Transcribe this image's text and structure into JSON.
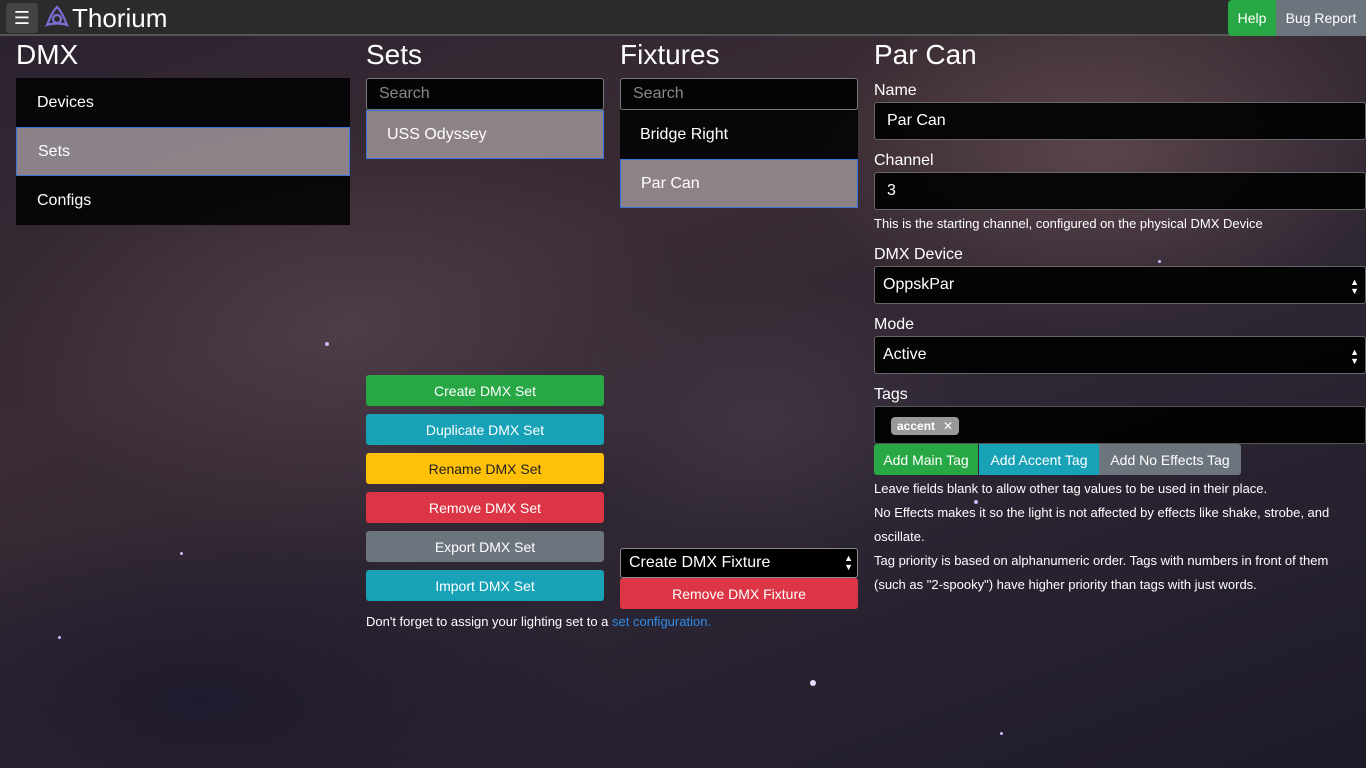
{
  "app": {
    "name": "Thorium",
    "help_label": "Help",
    "bug_report_label": "Bug Report"
  },
  "dmx": {
    "title": "DMX",
    "nav_items": [
      {
        "label": "Devices",
        "active": false
      },
      {
        "label": "Sets",
        "active": true
      },
      {
        "label": "Configs",
        "active": false
      }
    ]
  },
  "sets": {
    "title": "Sets",
    "search_placeholder": "Search",
    "items": [
      {
        "label": "USS Odyssey",
        "active": true
      }
    ],
    "buttons": {
      "create": "Create DMX Set",
      "duplicate": "Duplicate DMX Set",
      "rename": "Rename DMX Set",
      "remove": "Remove DMX Set",
      "export": "Export DMX Set",
      "import": "Import DMX Set"
    },
    "note_prefix": "Don't forget to assign your lighting set to a",
    "note_link": "set configuration."
  },
  "fixtures": {
    "title": "Fixtures",
    "search_placeholder": "Search",
    "items": [
      {
        "label": "Bridge Right",
        "active": false
      },
      {
        "label": "Par Can",
        "active": true
      }
    ],
    "create_select": "Create DMX Fixture",
    "remove_button": "Remove DMX Fixture"
  },
  "detail": {
    "title": "Par Can",
    "name_label": "Name",
    "name_value": "Par Can",
    "channel_label": "Channel",
    "channel_value": "3",
    "channel_help": "This is the starting channel, configured on the physical DMX Device",
    "device_label": "DMX Device",
    "device_value": "OppskPar",
    "mode_label": "Mode",
    "mode_value": "Active",
    "tags_label": "Tags",
    "tags": [
      "accent"
    ],
    "add_main_tag": "Add Main Tag",
    "add_accent_tag": "Add Accent Tag",
    "add_no_effects_tag": "Add No Effects Tag",
    "help_1": "Leave fields blank to allow other tag values to be used in their place.",
    "help_2": "No Effects makes it so the light is not affected by effects like shake, strobe, and oscillate.",
    "help_3": "Tag priority is based on alphanumeric order. Tags with numbers in front of them (such as \"2-spooky\") have higher priority than tags with just words."
  }
}
